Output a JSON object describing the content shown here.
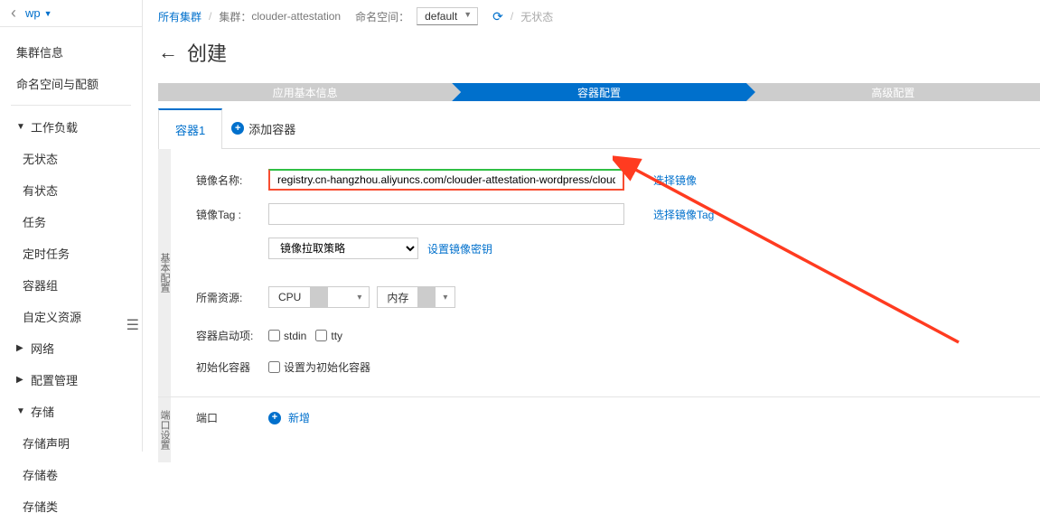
{
  "sidebar": {
    "cluster_name": "wp",
    "items": [
      {
        "label": "集群信息",
        "type": "plain"
      },
      {
        "label": "命名空间与配额",
        "type": "plain"
      },
      {
        "label": "divider"
      },
      {
        "label": "工作负载",
        "type": "expandable",
        "expanded": true
      },
      {
        "label": "无状态",
        "type": "indent"
      },
      {
        "label": "有状态",
        "type": "indent"
      },
      {
        "label": "任务",
        "type": "indent"
      },
      {
        "label": "定时任务",
        "type": "indent"
      },
      {
        "label": "容器组",
        "type": "indent"
      },
      {
        "label": "自定义资源",
        "type": "indent"
      },
      {
        "label": "网络",
        "type": "expandable",
        "expanded": false
      },
      {
        "label": "配置管理",
        "type": "expandable",
        "expanded": false
      },
      {
        "label": "存储",
        "type": "expandable",
        "expanded": true
      },
      {
        "label": "存储声明",
        "type": "indent"
      },
      {
        "label": "存储卷",
        "type": "indent"
      },
      {
        "label": "存储类",
        "type": "indent"
      }
    ]
  },
  "breadcrumb": {
    "all_clusters": "所有集群",
    "cluster_prefix": "集群：",
    "cluster_value": "clouder-attestation",
    "ns_prefix": "命名空间：",
    "ns_value": "default",
    "stateless": "无状态"
  },
  "page_title": "创建",
  "steps": {
    "s1": "应用基本信息",
    "s2": "容器配置",
    "s3": "高级配置"
  },
  "tabs": {
    "t1": "容器1",
    "add": "添加容器"
  },
  "form": {
    "section_label": "基本配置",
    "image_name_label": "镜像名称:",
    "image_name_value": "registry.cn-hangzhou.aliyuncs.com/clouder-attestation-wordpress/clouder-attestation",
    "select_image": "选择镜像",
    "image_tag_label": "镜像Tag :",
    "image_tag_value": "",
    "select_tag": "选择镜像Tag",
    "pull_policy": "镜像拉取策略",
    "set_secret": "设置镜像密钥",
    "resources_label": "所需资源:",
    "cpu": "CPU",
    "memory": "内存",
    "startup_label": "容器启动项:",
    "stdin": "stdin",
    "tty": "tty",
    "init_label": "初始化容器",
    "init_check": "设置为初始化容器",
    "port_section_label": "端口设置",
    "port_label": "端口",
    "add_port": "新增"
  }
}
